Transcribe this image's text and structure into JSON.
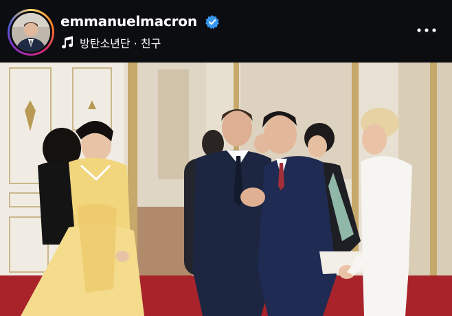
{
  "post_header": {
    "username": "emmanuelmacron",
    "verified": true,
    "music_label": "방탄소년단 · 친구",
    "avatar_icon": "profile-avatar",
    "music_icon": "music-note-icon",
    "more_icon": "more-options-icon"
  },
  "colors": {
    "header_bg": "#0c0d10",
    "verified_blue": "#3897f0",
    "text": "#ffffff"
  }
}
